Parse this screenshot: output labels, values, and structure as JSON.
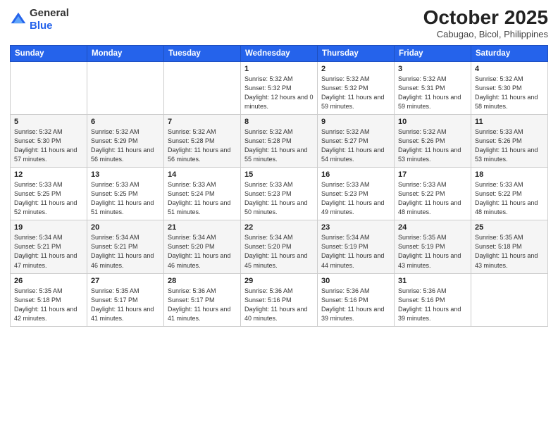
{
  "logo": {
    "general": "General",
    "blue": "Blue"
  },
  "header": {
    "month": "October 2025",
    "location": "Cabugao, Bicol, Philippines"
  },
  "weekdays": [
    "Sunday",
    "Monday",
    "Tuesday",
    "Wednesday",
    "Thursday",
    "Friday",
    "Saturday"
  ],
  "weeks": [
    [
      {
        "day": "",
        "sunrise": "",
        "sunset": "",
        "daylight": ""
      },
      {
        "day": "",
        "sunrise": "",
        "sunset": "",
        "daylight": ""
      },
      {
        "day": "",
        "sunrise": "",
        "sunset": "",
        "daylight": ""
      },
      {
        "day": "1",
        "sunrise": "Sunrise: 5:32 AM",
        "sunset": "Sunset: 5:32 PM",
        "daylight": "Daylight: 12 hours and 0 minutes."
      },
      {
        "day": "2",
        "sunrise": "Sunrise: 5:32 AM",
        "sunset": "Sunset: 5:32 PM",
        "daylight": "Daylight: 11 hours and 59 minutes."
      },
      {
        "day": "3",
        "sunrise": "Sunrise: 5:32 AM",
        "sunset": "Sunset: 5:31 PM",
        "daylight": "Daylight: 11 hours and 59 minutes."
      },
      {
        "day": "4",
        "sunrise": "Sunrise: 5:32 AM",
        "sunset": "Sunset: 5:30 PM",
        "daylight": "Daylight: 11 hours and 58 minutes."
      }
    ],
    [
      {
        "day": "5",
        "sunrise": "Sunrise: 5:32 AM",
        "sunset": "Sunset: 5:30 PM",
        "daylight": "Daylight: 11 hours and 57 minutes."
      },
      {
        "day": "6",
        "sunrise": "Sunrise: 5:32 AM",
        "sunset": "Sunset: 5:29 PM",
        "daylight": "Daylight: 11 hours and 56 minutes."
      },
      {
        "day": "7",
        "sunrise": "Sunrise: 5:32 AM",
        "sunset": "Sunset: 5:28 PM",
        "daylight": "Daylight: 11 hours and 56 minutes."
      },
      {
        "day": "8",
        "sunrise": "Sunrise: 5:32 AM",
        "sunset": "Sunset: 5:28 PM",
        "daylight": "Daylight: 11 hours and 55 minutes."
      },
      {
        "day": "9",
        "sunrise": "Sunrise: 5:32 AM",
        "sunset": "Sunset: 5:27 PM",
        "daylight": "Daylight: 11 hours and 54 minutes."
      },
      {
        "day": "10",
        "sunrise": "Sunrise: 5:32 AM",
        "sunset": "Sunset: 5:26 PM",
        "daylight": "Daylight: 11 hours and 53 minutes."
      },
      {
        "day": "11",
        "sunrise": "Sunrise: 5:33 AM",
        "sunset": "Sunset: 5:26 PM",
        "daylight": "Daylight: 11 hours and 53 minutes."
      }
    ],
    [
      {
        "day": "12",
        "sunrise": "Sunrise: 5:33 AM",
        "sunset": "Sunset: 5:25 PM",
        "daylight": "Daylight: 11 hours and 52 minutes."
      },
      {
        "day": "13",
        "sunrise": "Sunrise: 5:33 AM",
        "sunset": "Sunset: 5:25 PM",
        "daylight": "Daylight: 11 hours and 51 minutes."
      },
      {
        "day": "14",
        "sunrise": "Sunrise: 5:33 AM",
        "sunset": "Sunset: 5:24 PM",
        "daylight": "Daylight: 11 hours and 51 minutes."
      },
      {
        "day": "15",
        "sunrise": "Sunrise: 5:33 AM",
        "sunset": "Sunset: 5:23 PM",
        "daylight": "Daylight: 11 hours and 50 minutes."
      },
      {
        "day": "16",
        "sunrise": "Sunrise: 5:33 AM",
        "sunset": "Sunset: 5:23 PM",
        "daylight": "Daylight: 11 hours and 49 minutes."
      },
      {
        "day": "17",
        "sunrise": "Sunrise: 5:33 AM",
        "sunset": "Sunset: 5:22 PM",
        "daylight": "Daylight: 11 hours and 48 minutes."
      },
      {
        "day": "18",
        "sunrise": "Sunrise: 5:33 AM",
        "sunset": "Sunset: 5:22 PM",
        "daylight": "Daylight: 11 hours and 48 minutes."
      }
    ],
    [
      {
        "day": "19",
        "sunrise": "Sunrise: 5:34 AM",
        "sunset": "Sunset: 5:21 PM",
        "daylight": "Daylight: 11 hours and 47 minutes."
      },
      {
        "day": "20",
        "sunrise": "Sunrise: 5:34 AM",
        "sunset": "Sunset: 5:21 PM",
        "daylight": "Daylight: 11 hours and 46 minutes."
      },
      {
        "day": "21",
        "sunrise": "Sunrise: 5:34 AM",
        "sunset": "Sunset: 5:20 PM",
        "daylight": "Daylight: 11 hours and 46 minutes."
      },
      {
        "day": "22",
        "sunrise": "Sunrise: 5:34 AM",
        "sunset": "Sunset: 5:20 PM",
        "daylight": "Daylight: 11 hours and 45 minutes."
      },
      {
        "day": "23",
        "sunrise": "Sunrise: 5:34 AM",
        "sunset": "Sunset: 5:19 PM",
        "daylight": "Daylight: 11 hours and 44 minutes."
      },
      {
        "day": "24",
        "sunrise": "Sunrise: 5:35 AM",
        "sunset": "Sunset: 5:19 PM",
        "daylight": "Daylight: 11 hours and 43 minutes."
      },
      {
        "day": "25",
        "sunrise": "Sunrise: 5:35 AM",
        "sunset": "Sunset: 5:18 PM",
        "daylight": "Daylight: 11 hours and 43 minutes."
      }
    ],
    [
      {
        "day": "26",
        "sunrise": "Sunrise: 5:35 AM",
        "sunset": "Sunset: 5:18 PM",
        "daylight": "Daylight: 11 hours and 42 minutes."
      },
      {
        "day": "27",
        "sunrise": "Sunrise: 5:35 AM",
        "sunset": "Sunset: 5:17 PM",
        "daylight": "Daylight: 11 hours and 41 minutes."
      },
      {
        "day": "28",
        "sunrise": "Sunrise: 5:36 AM",
        "sunset": "Sunset: 5:17 PM",
        "daylight": "Daylight: 11 hours and 41 minutes."
      },
      {
        "day": "29",
        "sunrise": "Sunrise: 5:36 AM",
        "sunset": "Sunset: 5:16 PM",
        "daylight": "Daylight: 11 hours and 40 minutes."
      },
      {
        "day": "30",
        "sunrise": "Sunrise: 5:36 AM",
        "sunset": "Sunset: 5:16 PM",
        "daylight": "Daylight: 11 hours and 39 minutes."
      },
      {
        "day": "31",
        "sunrise": "Sunrise: 5:36 AM",
        "sunset": "Sunset: 5:16 PM",
        "daylight": "Daylight: 11 hours and 39 minutes."
      },
      {
        "day": "",
        "sunrise": "",
        "sunset": "",
        "daylight": ""
      }
    ]
  ]
}
